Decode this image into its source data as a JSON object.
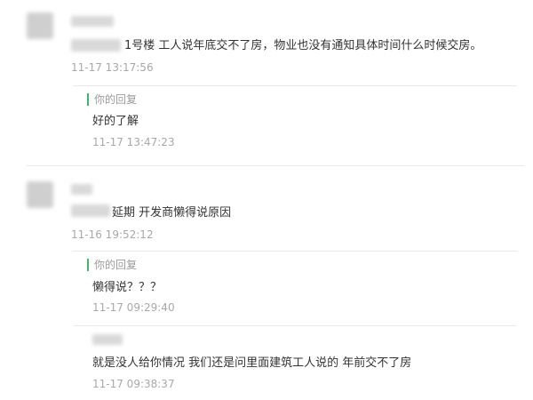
{
  "comments": [
    {
      "text_visible": "1号楼 工人说年底交不了房，物业也没有通知具体时间什么时候交房。",
      "time": "11-17 13:17:56",
      "reply": {
        "label": "你的回复",
        "text": "好的了解",
        "time": "11-17 13:47:23"
      }
    },
    {
      "text_visible": "延期 开发商懒得说原因",
      "time": "11-16 19:52:12",
      "reply": {
        "label": "你的回复",
        "text": "懒得说？？？",
        "time": "11-17 09:29:40"
      },
      "followup": {
        "text": "就是没人给你情况 我们还是问里面建筑工人说的 年前交不了房",
        "time": "11-17 09:38:37"
      }
    }
  ]
}
